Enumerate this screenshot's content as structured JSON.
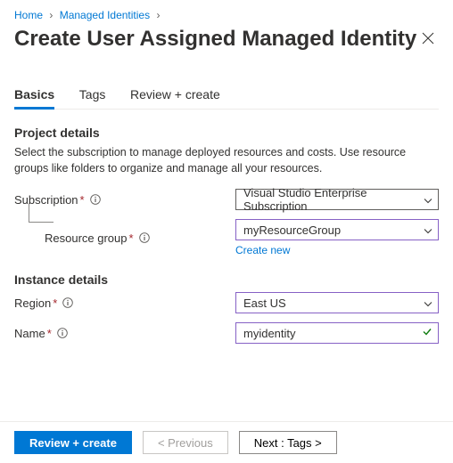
{
  "breadcrumb": {
    "home": "Home",
    "managed_identities": "Managed Identities"
  },
  "title": "Create User Assigned Managed Identity",
  "tabs": {
    "basics": "Basics",
    "tags": "Tags",
    "review": "Review + create"
  },
  "sections": {
    "project_details_title": "Project details",
    "project_details_desc": "Select the subscription to manage deployed resources and costs. Use resource groups like folders to organize and manage all your resources.",
    "instance_details_title": "Instance details"
  },
  "fields": {
    "subscription": {
      "label": "Subscription",
      "value": "Visual Studio Enterprise Subscription"
    },
    "resource_group": {
      "label": "Resource group",
      "value": "myResourceGroup",
      "create_new": "Create new"
    },
    "region": {
      "label": "Region",
      "value": "East US"
    },
    "name": {
      "label": "Name",
      "value": "myidentity"
    }
  },
  "footer": {
    "review_create": "Review + create",
    "previous": "< Previous",
    "next": "Next : Tags >"
  }
}
